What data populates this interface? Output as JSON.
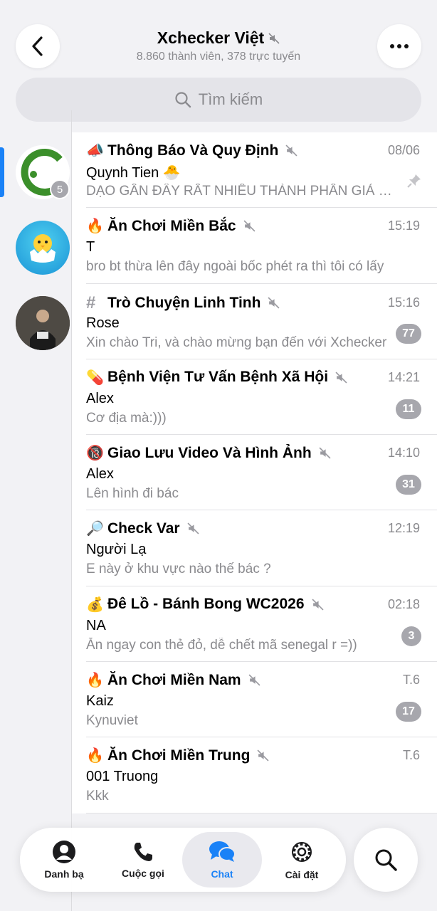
{
  "header": {
    "title": "Xchecker Việt",
    "subtitle": "8.860 thành viên, 378 trực tuyến"
  },
  "search": {
    "placeholder": "Tìm kiếm"
  },
  "sidebar": {
    "badge_count": "5"
  },
  "chats": [
    {
      "emoji": "📣",
      "title": "Thông Báo Và Quy Định",
      "time": "08/06",
      "sender": "Quynh Tien 🐣",
      "preview": "DẠO GẦN ĐÂY RẤT NHIỀU THÀNH PHẦN GIẢ MẠO",
      "pinned": true
    },
    {
      "emoji": "🔥",
      "title": "Ăn Chơi Miền Bắc",
      "time": "15:19",
      "sender": "T",
      "preview": "bro bt thừa lên đây ngoài bốc phét ra thì tôi có lấy",
      "count": ""
    },
    {
      "emoji": "#",
      "title": "Trò Chuyện Linh Tinh",
      "time": "15:16",
      "sender": "Rose",
      "preview": "Xin chào Tri, và chào mừng bạn đến với Xchecker",
      "count": "77"
    },
    {
      "emoji": "💊",
      "title": "Bệnh Viện Tư Vấn Bệnh Xã Hội",
      "time": "14:21",
      "sender": "Alex",
      "preview": "Cơ địa mà:)))",
      "count": "11"
    },
    {
      "emoji": "🔞",
      "title": "Giao Lưu Video Và Hình Ảnh",
      "time": "14:10",
      "sender": "Alex",
      "preview": "Lên hình đi bác",
      "count": "31"
    },
    {
      "emoji": "🔎",
      "title": "Check Var",
      "time": "12:19",
      "sender": "Người Lạ",
      "preview": "E này ở khu vực nào thế bác ?",
      "count": ""
    },
    {
      "emoji": "💰",
      "title": "Đê Lồ - Bánh Bong WC2026",
      "time": "02:18",
      "sender": "NA",
      "preview": "Ăn ngay con thẻ đỏ, dễ chết mã senegal r =))",
      "count": "3"
    },
    {
      "emoji": "🔥",
      "title": "Ăn Chơi Miền Nam",
      "time": "T.6",
      "sender": "Kaiz",
      "preview": "Kynuviet",
      "count": "17"
    },
    {
      "emoji": "🔥",
      "title": "Ăn Chơi Miền Trung",
      "time": "T.6",
      "sender": "001 Truong",
      "preview": "Kkk",
      "count": ""
    }
  ],
  "tabs": [
    {
      "label": "Danh bạ",
      "icon": "person-icon"
    },
    {
      "label": "Cuộc gọi",
      "icon": "phone-icon"
    },
    {
      "label": "Chat",
      "icon": "chat-bubbles-icon",
      "active": true
    },
    {
      "label": "Cài đặt",
      "icon": "gear-icon"
    }
  ],
  "colors": {
    "accent": "#1a82f7",
    "badge": "#a7a7ad",
    "muted_text": "#8a8a8e",
    "logo_green": "#3b8f2a"
  }
}
